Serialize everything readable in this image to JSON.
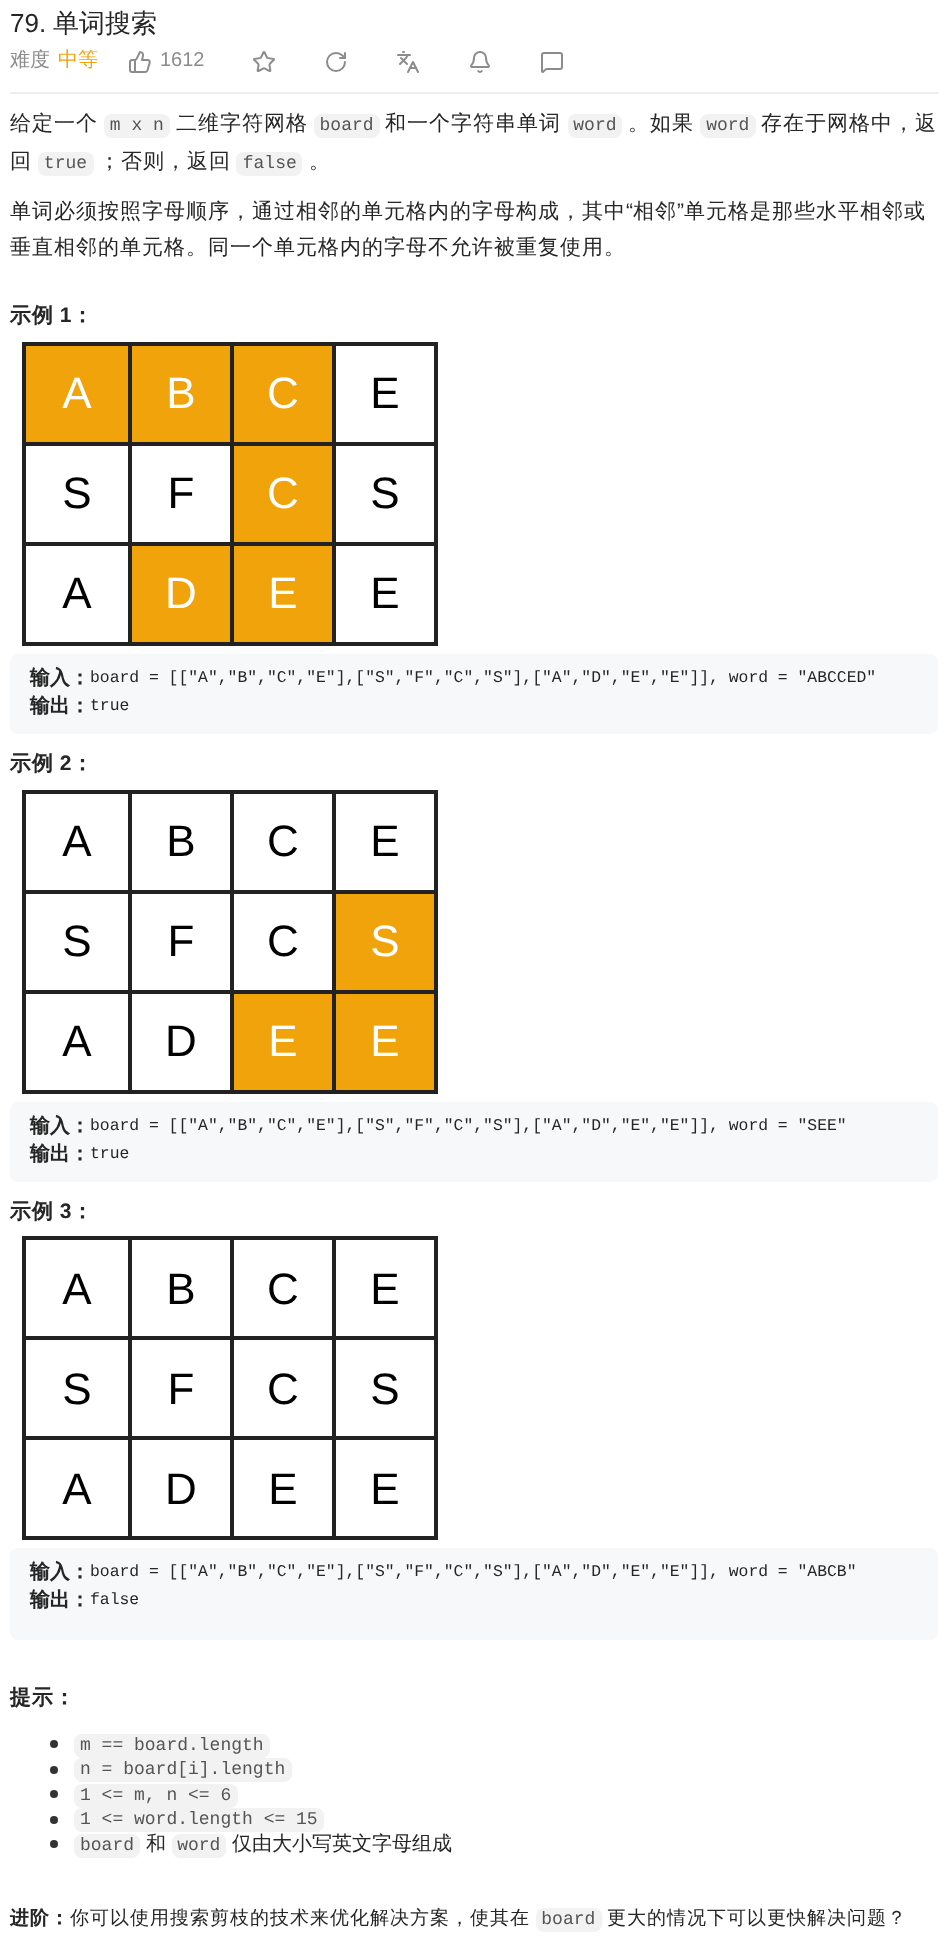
{
  "title": "79. 单词搜索",
  "meta": {
    "difficulty_label": "难度",
    "difficulty": "中等",
    "likes": "1612"
  },
  "description": [
    [
      {
        "kind": "text",
        "text": "给定一个 "
      },
      {
        "kind": "code",
        "text": "m x n"
      },
      {
        "kind": "text",
        "text": " 二维字符网格 "
      },
      {
        "kind": "code",
        "text": "board"
      },
      {
        "kind": "text",
        "text": " 和一个字符串单词 "
      },
      {
        "kind": "code",
        "text": "word"
      },
      {
        "kind": "text",
        "text": " 。如果 "
      },
      {
        "kind": "code",
        "text": "word"
      },
      {
        "kind": "text",
        "text": " 存在于网格中，返回 "
      },
      {
        "kind": "code",
        "text": "true"
      },
      {
        "kind": "text",
        "text": " ；否则，返回 "
      },
      {
        "kind": "code",
        "text": "false"
      },
      {
        "kind": "text",
        "text": " 。"
      }
    ],
    [
      {
        "kind": "text",
        "text": "单词必须按照字母顺序，通过相邻的单元格内的字母构成，其中“相邻”单元格是那些水平相邻或垂直相邻的单元格。同一个单元格内的字母不允许被重复使用。"
      }
    ]
  ],
  "examples": [
    {
      "heading": "示例 1：",
      "grid": [
        [
          {
            "letter": "A",
            "selected": true
          },
          {
            "letter": "B",
            "selected": true
          },
          {
            "letter": "C",
            "selected": true
          },
          {
            "letter": "E",
            "selected": false
          }
        ],
        [
          {
            "letter": "S",
            "selected": false
          },
          {
            "letter": "F",
            "selected": false
          },
          {
            "letter": "C",
            "selected": true
          },
          {
            "letter": "S",
            "selected": false
          }
        ],
        [
          {
            "letter": "A",
            "selected": false
          },
          {
            "letter": "D",
            "selected": true
          },
          {
            "letter": "E",
            "selected": true
          },
          {
            "letter": "E",
            "selected": false
          }
        ]
      ],
      "input_label": "输入：",
      "input": "board = [[\"A\",\"B\",\"C\",\"E\"],[\"S\",\"F\",\"C\",\"S\"],[\"A\",\"D\",\"E\",\"E\"]], word = \"ABCCED\"",
      "output_label": "输出：",
      "output": "true"
    },
    {
      "heading": "示例 2：",
      "grid": [
        [
          {
            "letter": "A",
            "selected": false
          },
          {
            "letter": "B",
            "selected": false
          },
          {
            "letter": "C",
            "selected": false
          },
          {
            "letter": "E",
            "selected": false
          }
        ],
        [
          {
            "letter": "S",
            "selected": false
          },
          {
            "letter": "F",
            "selected": false
          },
          {
            "letter": "C",
            "selected": false
          },
          {
            "letter": "S",
            "selected": true
          }
        ],
        [
          {
            "letter": "A",
            "selected": false
          },
          {
            "letter": "D",
            "selected": false
          },
          {
            "letter": "E",
            "selected": true
          },
          {
            "letter": "E",
            "selected": true
          }
        ]
      ],
      "input_label": "输入：",
      "input": "board = [[\"A\",\"B\",\"C\",\"E\"],[\"S\",\"F\",\"C\",\"S\"],[\"A\",\"D\",\"E\",\"E\"]], word = \"SEE\"",
      "output_label": "输出：",
      "output": "true"
    },
    {
      "heading": "示例 3：",
      "grid": [
        [
          {
            "letter": "A",
            "selected": false
          },
          {
            "letter": "B",
            "selected": false
          },
          {
            "letter": "C",
            "selected": false
          },
          {
            "letter": "E",
            "selected": false
          }
        ],
        [
          {
            "letter": "S",
            "selected": false
          },
          {
            "letter": "F",
            "selected": false
          },
          {
            "letter": "C",
            "selected": false
          },
          {
            "letter": "S",
            "selected": false
          }
        ],
        [
          {
            "letter": "A",
            "selected": false
          },
          {
            "letter": "D",
            "selected": false
          },
          {
            "letter": "E",
            "selected": false
          },
          {
            "letter": "E",
            "selected": false
          }
        ]
      ],
      "input_label": "输入：",
      "input": "board = [[\"A\",\"B\",\"C\",\"E\"],[\"S\",\"F\",\"C\",\"S\"],[\"A\",\"D\",\"E\",\"E\"]], word = \"ABCB\"",
      "output_label": "输出：",
      "output": "false"
    }
  ],
  "hints_heading": "提示：",
  "hints": [
    [
      {
        "kind": "code",
        "text": "m == board.length"
      }
    ],
    [
      {
        "kind": "code",
        "text": "n = board[i].length"
      }
    ],
    [
      {
        "kind": "code",
        "text": "1 <= m, n <= 6"
      }
    ],
    [
      {
        "kind": "code",
        "text": "1 <= word.length <= 15"
      }
    ],
    [
      {
        "kind": "code",
        "text": "board"
      },
      {
        "kind": "text",
        "text": " 和 "
      },
      {
        "kind": "code",
        "text": "word"
      },
      {
        "kind": "text",
        "text": " 仅由大小写英文字母组成"
      }
    ]
  ],
  "followup": {
    "label": "进阶：",
    "text": [
      {
        "kind": "text",
        "text": "你可以使用搜索剪枝的技术来优化解决方案，使其在 "
      },
      {
        "kind": "code",
        "text": "board"
      },
      {
        "kind": "text",
        "text": " 更大的情况下可以更快解决问题？"
      }
    ]
  }
}
